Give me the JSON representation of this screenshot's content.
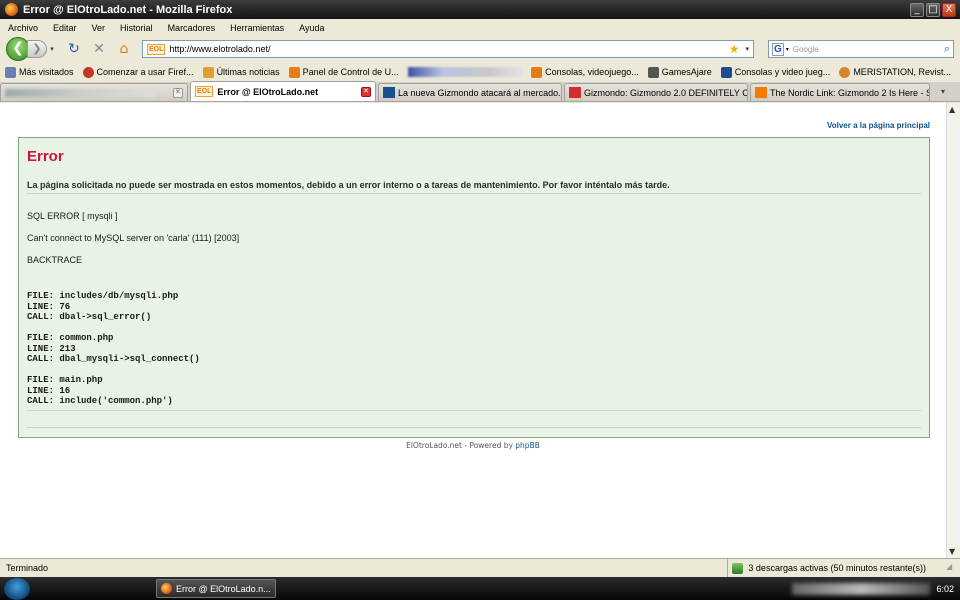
{
  "window": {
    "title": "Error @ ElOtroLado.net - Mozilla Firefox",
    "min": "_",
    "max": "□",
    "close": "X"
  },
  "menu": [
    "Archivo",
    "Editar",
    "Ver",
    "Historial",
    "Marcadores",
    "Herramientas",
    "Ayuda"
  ],
  "nav": {
    "back": "❮",
    "forward": "❯",
    "dropdown": "▾",
    "reload": "↻",
    "stop": "✕",
    "home": "⌂",
    "url": "http://www.elotrolado.net/",
    "url_favicon": "EOL",
    "search_engine": "G",
    "search_placeholder": "Google"
  },
  "bookmarks": [
    {
      "label": "Más visitados",
      "icon": "star-folder-icon",
      "color": "#6c7fb5"
    },
    {
      "label": "Comenzar a usar Firef...",
      "icon": "firefox-help-icon",
      "color": "#c0392b"
    },
    {
      "label": "Últimas noticias",
      "icon": "rss-folder-icon",
      "color": "#e0a030"
    },
    {
      "label": "Panel de Control de U...",
      "icon": "eol-icon",
      "color": "#e87b14"
    }
  ],
  "bookmarks_after_blur": [
    {
      "label": "Consolas, videojuego...",
      "icon": "eol-icon",
      "color": "#e87b14"
    },
    {
      "label": "GamesAjare",
      "icon": "cube-icon",
      "color": "#555555"
    },
    {
      "label": "Consolas y video jueg...",
      "icon": "vc-icon",
      "color": "#1b4f8e"
    },
    {
      "label": "MERISTATION, Revist...",
      "icon": "meristation-icon",
      "color": "#d4862a"
    }
  ],
  "tabs": [
    {
      "label": "",
      "active": false,
      "blurred": true
    },
    {
      "label": "Error @ ElOtroLado.net",
      "active": true,
      "icon_text": "EOL"
    },
    {
      "label": "La nueva Gizmondo atacará al mercado...",
      "active": false,
      "icon_color": "#1b4f8e"
    },
    {
      "label": "Gizmondo: Gizmondo 2.0 DEFINITELY O...",
      "active": false,
      "icon_color": "#d32f2f"
    },
    {
      "label": "The Nordic Link: Gizmondo 2 Is Here - S...",
      "active": false,
      "icon_color": "#f57c00"
    }
  ],
  "page": {
    "top_link": "Volver a la página principal",
    "error_title": "Error",
    "error_message": "La página solicitada no puede ser mostrada en estos momentos, debido a un error interno o a tareas de mantenimiento. Por favor inténtalo más tarde.",
    "sql_error": "SQL ERROR [ mysqli ]",
    "connect_error": "Can't connect to MySQL server on 'carla' (111) [2003]",
    "backtrace": "BACKTRACE",
    "trace_1": "FILE: includes/db/mysqli.php\nLINE: 76\nCALL: dbal->sql_error()",
    "trace_2": "FILE: common.php\nLINE: 213\nCALL: dbal_mysqli->sql_connect()",
    "trace_3": "FILE: main.php\nLINE: 16\nCALL: include('common.php')",
    "footer_site": "ElOtroLado.net",
    "footer_sep": " - Powered by ",
    "footer_phpbb": "phpBB"
  },
  "status": {
    "left": "Terminado",
    "downloads": "3 descargas activas (50 minutos restante(s))"
  },
  "taskbar": {
    "window_button": "Error @ ElOtroLado.n...",
    "clock": "6:02"
  },
  "colors": {
    "error_title": "#d31141",
    "link": "#105289",
    "panel_bg": "#e8f3e6",
    "panel_border": "#7ea87a"
  }
}
